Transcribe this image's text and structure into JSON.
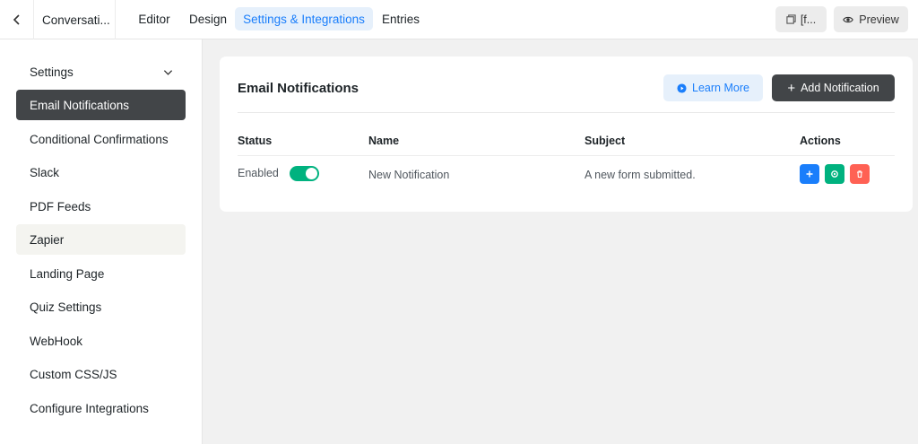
{
  "header": {
    "form_title": "Conversati...",
    "tabs": [
      {
        "label": "Editor"
      },
      {
        "label": "Design"
      },
      {
        "label": "Settings & Integrations"
      },
      {
        "label": "Entries"
      }
    ],
    "active_tab": "Settings & Integrations",
    "shortcode_label": "[f...",
    "preview_label": "Preview"
  },
  "sidebar": {
    "items": [
      {
        "label": "Settings"
      },
      {
        "label": "Email Notifications"
      },
      {
        "label": "Conditional Confirmations"
      },
      {
        "label": "Slack"
      },
      {
        "label": "PDF Feeds"
      },
      {
        "label": "Zapier"
      },
      {
        "label": "Landing Page"
      },
      {
        "label": "Quiz Settings"
      },
      {
        "label": "WebHook"
      },
      {
        "label": "Custom CSS/JS"
      },
      {
        "label": "Configure Integrations"
      }
    ],
    "active_item": "Email Notifications"
  },
  "main": {
    "title": "Email Notifications",
    "learn_more_label": "Learn More",
    "add_notification_label": "Add Notification",
    "table": {
      "headers": [
        "Status",
        "Name",
        "Subject",
        "Actions"
      ],
      "rows": [
        {
          "status": "Enabled",
          "enabled": true,
          "name": "New Notification",
          "subject": "A new form submitted."
        }
      ]
    }
  },
  "colors": {
    "accent": "#1a7efb",
    "success": "#00b27f",
    "danger": "#ff6154",
    "dark": "#424548"
  }
}
